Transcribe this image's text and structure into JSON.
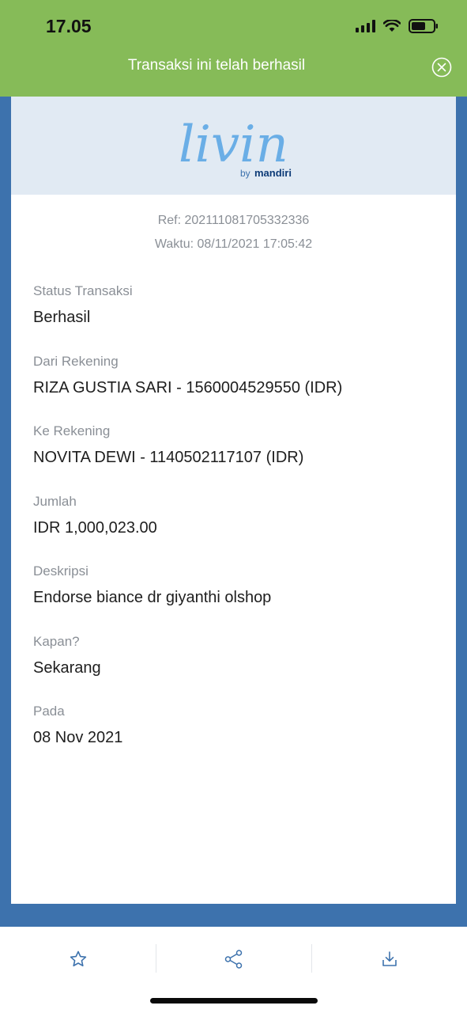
{
  "status_bar": {
    "time": "17.05"
  },
  "banner": {
    "message": "Transaksi ini telah berhasil"
  },
  "logo": {
    "brand": "livin'",
    "sub_prefix": "by",
    "sub_brand": "mandiri"
  },
  "receipt": {
    "ref": "Ref: 202111081705332336",
    "time": "Waktu: 08/11/2021 17:05:42",
    "fields": [
      {
        "label": "Status Transaksi",
        "value": "Berhasil"
      },
      {
        "label": "Dari Rekening",
        "value": "RIZA GUSTIA SARI - 1560004529550 (IDR)"
      },
      {
        "label": "Ke Rekening",
        "value": "NOVITA DEWI - 1140502117107 (IDR)"
      },
      {
        "label": "Jumlah",
        "value": "IDR 1,000,023.00"
      },
      {
        "label": "Deskripsi",
        "value": "Endorse biance dr giyanthi olshop"
      },
      {
        "label": "Kapan?",
        "value": "Sekarang"
      },
      {
        "label": "Pada",
        "value": "08 Nov 2021"
      }
    ]
  },
  "actions": {
    "favorite_icon": "star-icon",
    "share_icon": "share-icon",
    "download_icon": "download-icon"
  },
  "colors": {
    "banner_green": "#86bb58",
    "frame_blue": "#3d72ad",
    "logo_bg": "#e1eaf3",
    "logo_blue": "#6aaee6",
    "logo_accent": "#f2b705",
    "icon_blue": "#3d72ad"
  }
}
